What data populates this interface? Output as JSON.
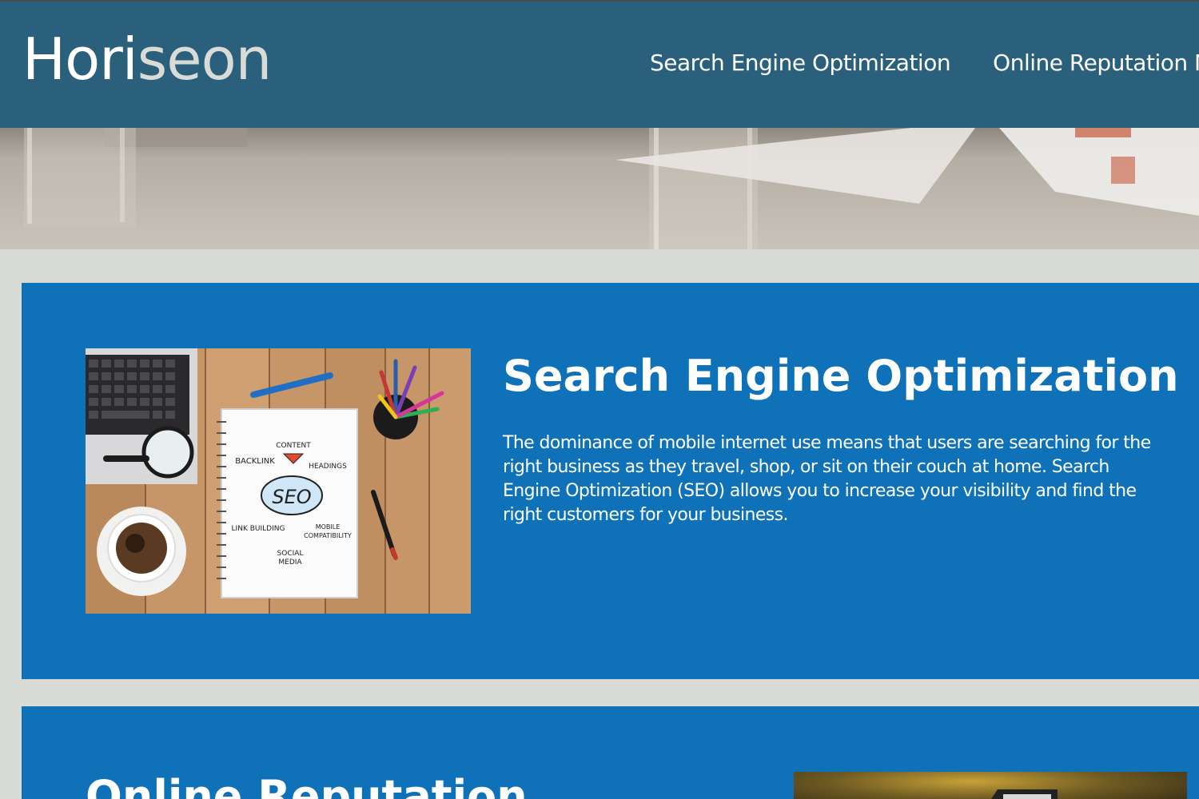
{
  "header": {
    "logo_part1": "Hori",
    "logo_part2": "seon",
    "nav": [
      {
        "label": "Search Engine Optimization"
      },
      {
        "label": "Online Reputation Ma"
      }
    ]
  },
  "sections": [
    {
      "title": "Search Engine Optimization",
      "body": "The dominance of mobile internet use means that users are searching for the right business as they travel, shop, or sit on their couch at home. Search Engine Optimization (SEO) allows you to increase your visibility and find the right customers for your business.",
      "image_labels": {
        "content": "CONTENT",
        "backlink": "BACKLINK",
        "headings": "HEADINGS",
        "seo": "SEO",
        "link_building": "LINK BUILDING",
        "mobile": "MOBILE",
        "compatibility": "COMPATIBILITY",
        "social": "SOCIAL",
        "media": "MEDIA"
      }
    },
    {
      "title": "Online Reputation"
    }
  ],
  "colors": {
    "header_bg": "#2a607c",
    "section_bg": "#0f72b9",
    "page_bg": "#d9dcd6",
    "logo_accent": "#d9dcd6"
  }
}
